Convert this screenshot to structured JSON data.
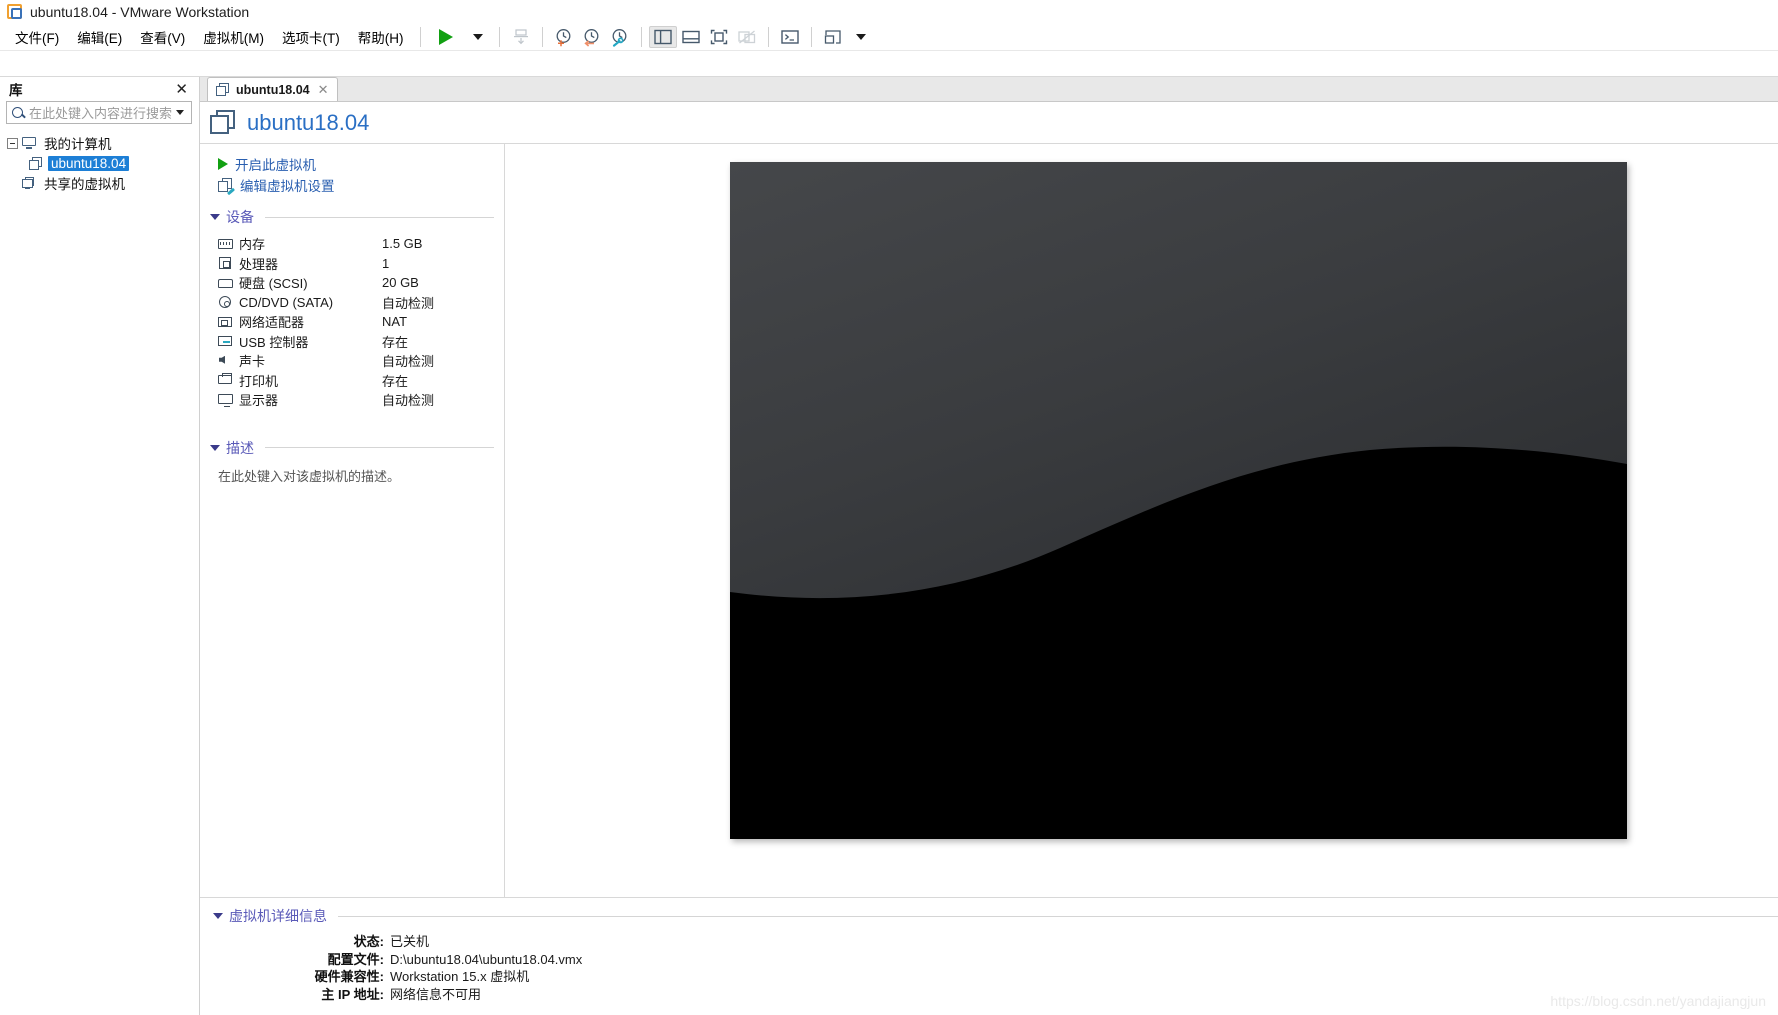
{
  "window": {
    "title": "ubuntu18.04 - VMware Workstation",
    "app_icon": "vmware-logo-icon"
  },
  "menubar": {
    "items": [
      {
        "label": "文件(F)",
        "name": "menu-file"
      },
      {
        "label": "编辑(E)",
        "name": "menu-edit"
      },
      {
        "label": "查看(V)",
        "name": "menu-view"
      },
      {
        "label": "虚拟机(M)",
        "name": "menu-vm"
      },
      {
        "label": "选项卡(T)",
        "name": "menu-tabs"
      },
      {
        "label": "帮助(H)",
        "name": "menu-help"
      }
    ]
  },
  "toolbar": {
    "buttons": [
      {
        "name": "power-on-button",
        "icon": "play-icon"
      },
      {
        "name": "power-dropdown-button",
        "icon": "chevron-down-icon"
      },
      {
        "name": "manage-snapshot-button",
        "icon": "snapshot-manage-icon"
      },
      {
        "name": "take-snapshot-button",
        "icon": "snapshot-add-icon"
      },
      {
        "name": "revert-snapshot-button",
        "icon": "snapshot-revert-icon"
      },
      {
        "name": "snapshot-manager-button",
        "icon": "snapshot-settings-icon"
      },
      {
        "name": "show-library-button",
        "icon": "library-panel-icon"
      },
      {
        "name": "show-thumbnail-bar-button",
        "icon": "thumbnail-bar-icon"
      },
      {
        "name": "full-screen-button",
        "icon": "fullscreen-icon"
      },
      {
        "name": "unity-mode-button",
        "icon": "unity-mode-icon"
      },
      {
        "name": "console-button",
        "icon": "console-icon"
      },
      {
        "name": "send-ctrl-alt-del-button",
        "icon": "send-keys-icon"
      },
      {
        "name": "send-keys-dropdown-button",
        "icon": "chevron-down-icon"
      }
    ]
  },
  "library": {
    "header_title": "库",
    "close_label": "✕",
    "search": {
      "placeholder": "在此处键入内容进行搜索",
      "value": ""
    },
    "tree": [
      {
        "label": "我的计算机",
        "name": "tree-item-my-computer",
        "icon": "monitor-icon",
        "level": 0,
        "expanded": true,
        "selected": false
      },
      {
        "label": "ubuntu18.04",
        "name": "tree-item-ubuntu18-04",
        "icon": "vm-icon",
        "level": 1,
        "expanded": false,
        "selected": true
      },
      {
        "label": "共享的虚拟机",
        "name": "tree-item-shared-vms",
        "icon": "shared-vm-icon",
        "level": 0,
        "expanded": false,
        "selected": false
      }
    ]
  },
  "tabs": [
    {
      "label": "ubuntu18.04",
      "name": "tab-ubuntu18-04",
      "active": true,
      "close_label": "✕"
    }
  ],
  "vm": {
    "name": "ubuntu18.04",
    "actions": [
      {
        "label": "开启此虚拟机",
        "name": "power-on-vm-link",
        "icon": "play-icon"
      },
      {
        "label": "编辑虚拟机设置",
        "name": "edit-vm-settings-link",
        "icon": "edit-settings-icon"
      }
    ],
    "devices_section": {
      "title": "设备",
      "expanded": true
    },
    "devices": [
      {
        "name": "内存",
        "value": "1.5 GB",
        "icon": "memory-icon"
      },
      {
        "name": "处理器",
        "value": "1",
        "icon": "cpu-icon"
      },
      {
        "name": "硬盘 (SCSI)",
        "value": "20 GB",
        "icon": "harddisk-icon"
      },
      {
        "name": "CD/DVD (SATA)",
        "value": "自动检测",
        "icon": "cddvd-icon"
      },
      {
        "name": "网络适配器",
        "value": "NAT",
        "icon": "network-icon"
      },
      {
        "name": "USB 控制器",
        "value": "存在",
        "icon": "usb-icon"
      },
      {
        "name": "声卡",
        "value": "自动检测",
        "icon": "sound-icon"
      },
      {
        "name": "打印机",
        "value": "存在",
        "icon": "printer-icon"
      },
      {
        "name": "显示器",
        "value": "自动检测",
        "icon": "display-icon"
      }
    ],
    "description_section": {
      "title": "描述",
      "expanded": true
    },
    "description_placeholder": "在此处键入对该虚拟机的描述。",
    "details_section": {
      "title": "虚拟机详细信息",
      "expanded": true
    },
    "details": [
      {
        "key": "状态:",
        "value": "已关机"
      },
      {
        "key": "配置文件:",
        "value": "D:\\ubuntu18.04\\ubuntu18.04.vmx"
      },
      {
        "key": "硬件兼容性:",
        "value": "Workstation 15.x 虚拟机"
      },
      {
        "key": "主 IP 地址:",
        "value": "网络信息不可用"
      }
    ]
  },
  "watermark": "https://blog.csdn.net/yandajiangjun",
  "colors": {
    "accent_link": "#2a6fc4",
    "section_title": "#5a5ab8",
    "selection_blue": "#1d7fd6",
    "play_green": "#12a012",
    "icon_slate": "#44617f"
  }
}
